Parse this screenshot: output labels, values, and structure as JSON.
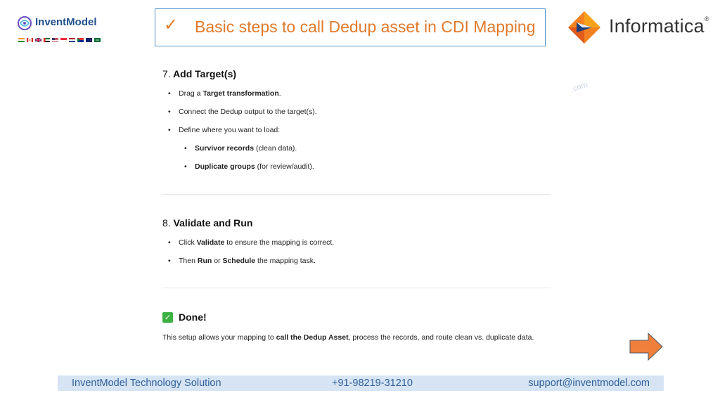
{
  "brand_left": {
    "name": "InventModel"
  },
  "header": {
    "check_icon": "check-icon",
    "title": "Basic steps to call Dedup asset in CDI Mapping"
  },
  "brand_right": {
    "name": "Informatica",
    "reg": "®"
  },
  "watermark": ".com",
  "sections": [
    {
      "number": "7.",
      "heading": "Add Target(s)",
      "bullets": [
        {
          "pre": "Drag a ",
          "bold": "Target transformation",
          "post": "."
        },
        {
          "pre": "Connect the Dedup output to the target(s).",
          "bold": "",
          "post": ""
        },
        {
          "pre": "Define where you want to load:",
          "bold": "",
          "post": ""
        }
      ],
      "sub_bullets": [
        {
          "bold": "Survivor records",
          "post": " (clean data)."
        },
        {
          "bold": "Duplicate groups",
          "post": " (for review/audit)."
        }
      ]
    },
    {
      "number": "8.",
      "heading": "Validate and Run",
      "bullets": [
        {
          "pre": "Click ",
          "bold": "Validate",
          "post": " to ensure the mapping is correct."
        },
        {
          "pre": "Then ",
          "bold": "Run",
          "mid": " or ",
          "bold2": "Schedule",
          "post": " the mapping task."
        }
      ]
    }
  ],
  "done": {
    "icon": "checkbox-checked-icon",
    "heading": "Done!",
    "text_pre": "This setup allows your mapping to ",
    "text_bold": "call the Dedup Asset",
    "text_post": ", process the records, and route clean vs. duplicate data."
  },
  "footer": {
    "company": "InventModel Technology Solution",
    "phone": "+91-98219-31210",
    "email": "support@inventmodel.com"
  },
  "colors": {
    "accent_orange": "#e07a2c",
    "footer_bg": "#d6e4f3",
    "footer_text": "#2f5f9a",
    "title_border": "#4a90c8"
  }
}
